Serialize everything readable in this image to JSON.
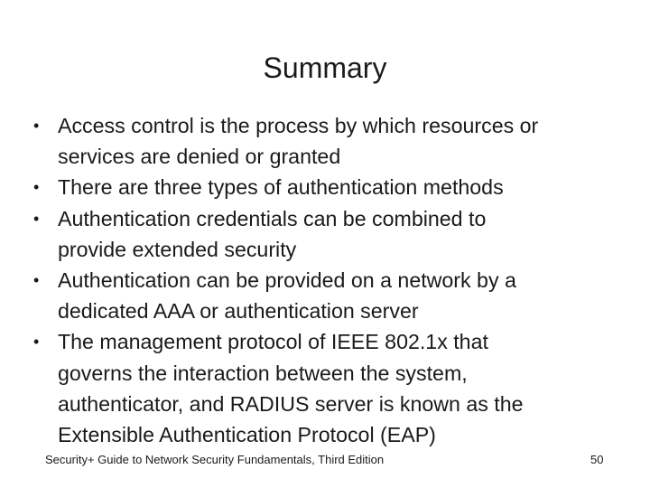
{
  "slide": {
    "title": "Summary",
    "bullets": [
      "Access control is the process by which resources or services are denied or granted",
      "There are three types of authentication methods",
      "Authentication credentials can be combined to provide extended security",
      "Authentication can be provided on a network by a dedicated AAA or authentication server",
      "The management protocol of IEEE 802.1x that governs the interaction between the system, authenticator, and RADIUS server is known as the Extensible Authentication Protocol (EAP)"
    ],
    "bullet_lines": [
      [
        "Access control is the process by which resources or",
        "services are denied or granted"
      ],
      [
        "There are three types of authentication methods"
      ],
      [
        "Authentication credentials can be combined to",
        "provide extended security"
      ],
      [
        "Authentication can be provided on a network by a",
        "dedicated AAA or authentication server"
      ],
      [
        "The management protocol of IEEE 802.1x that",
        "governs the interaction between the system,",
        "authenticator, and RADIUS server is known as the",
        "Extensible Authentication Protocol (EAP)"
      ]
    ],
    "bullet_glyph": "•"
  },
  "footer": {
    "source": "Security+ Guide to Network Security Fundamentals, Third Edition",
    "page_number": "50"
  }
}
